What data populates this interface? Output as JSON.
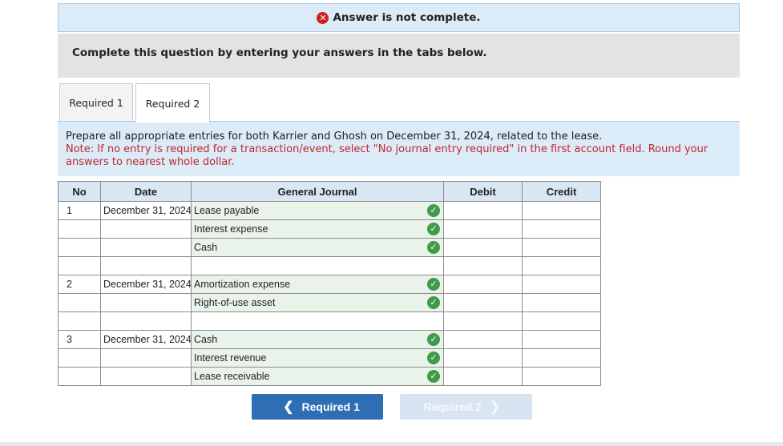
{
  "banner": {
    "icon": "x-icon",
    "text": "Answer is not complete."
  },
  "instruction": "Complete this question by entering your answers in the tabs below.",
  "tabs": [
    {
      "label": "Required 1"
    },
    {
      "label": "Required 2"
    }
  ],
  "question": {
    "text": "Prepare all appropriate entries for both Karrier and Ghosh on December 31, 2024, related to the lease.",
    "note": "Note: If no entry is required for a transaction/event, select \"No journal entry required\" in the first account field. Round your answers to nearest whole dollar."
  },
  "journal": {
    "headers": {
      "no": "No",
      "date": "Date",
      "general_journal": "General Journal",
      "debit": "Debit",
      "credit": "Credit"
    },
    "rows": [
      {
        "no": "1",
        "date": "December 31, 2024",
        "account": "Lease payable",
        "check": true,
        "debit": "",
        "credit": ""
      },
      {
        "no": "",
        "date": "",
        "account": "Interest expense",
        "check": true,
        "debit": "",
        "credit": ""
      },
      {
        "no": "",
        "date": "",
        "account": "Cash",
        "check": true,
        "debit": "",
        "credit": ""
      },
      {
        "no": "",
        "date": "",
        "account": "",
        "check": false,
        "debit": "",
        "credit": ""
      },
      {
        "no": "2",
        "date": "December 31, 2024",
        "account": "Amortization expense",
        "check": true,
        "debit": "",
        "credit": ""
      },
      {
        "no": "",
        "date": "",
        "account": "Right-of-use asset",
        "check": true,
        "debit": "",
        "credit": ""
      },
      {
        "no": "",
        "date": "",
        "account": "",
        "check": false,
        "debit": "",
        "credit": ""
      },
      {
        "no": "3",
        "date": "December 31, 2024",
        "account": "Cash",
        "check": true,
        "debit": "",
        "credit": ""
      },
      {
        "no": "",
        "date": "",
        "account": "Interest revenue",
        "check": true,
        "debit": "",
        "credit": ""
      },
      {
        "no": "",
        "date": "",
        "account": "Lease receivable",
        "check": true,
        "debit": "",
        "credit": ""
      }
    ]
  },
  "nav": {
    "prev_label": "Required 1",
    "next_label": "Required 2"
  },
  "colors": {
    "primary": "#2f6db5",
    "correct": "#3f9a4a",
    "error": "#d11f1f",
    "note": "#c0282d"
  }
}
